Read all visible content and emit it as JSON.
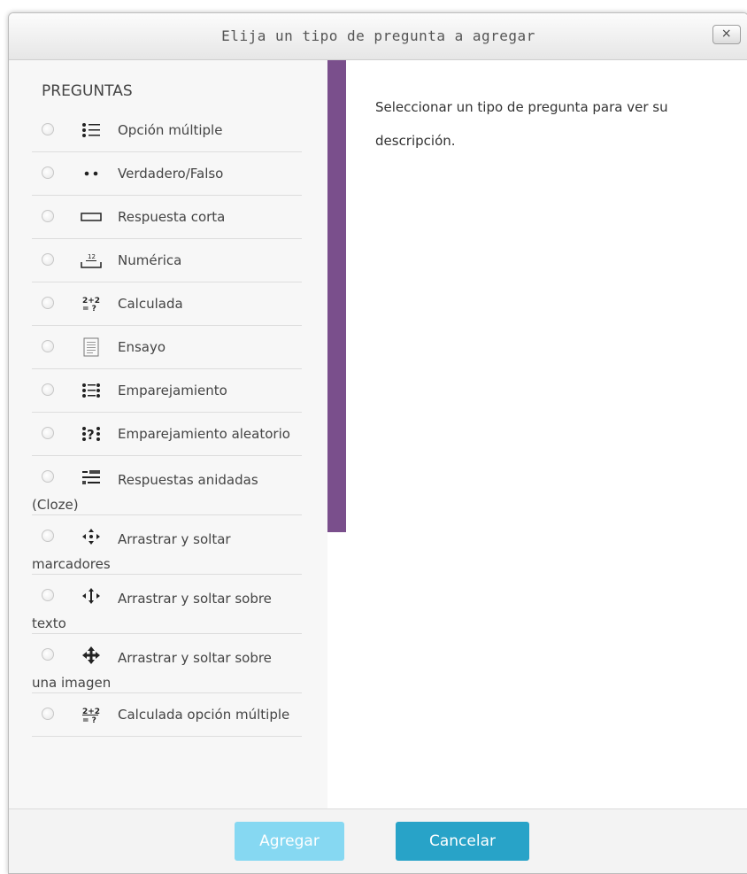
{
  "dialog": {
    "title": "Elija un tipo de pregunta a agregar",
    "close_label": "×",
    "section_title": "PREGUNTAS",
    "description": "Seleccionar un tipo de pregunta para ver su descripción.",
    "questions": [
      {
        "label": "Opción múltiple",
        "icon": "multichoice-icon"
      },
      {
        "label": "Verdadero/Falso",
        "icon": "truefalse-icon"
      },
      {
        "label": "Respuesta corta",
        "icon": "shortanswer-icon"
      },
      {
        "label": "Numérica",
        "icon": "numerical-icon"
      },
      {
        "label": "Calculada",
        "icon": "calculated-icon"
      },
      {
        "label": "Ensayo",
        "icon": "essay-icon"
      },
      {
        "label": "Emparejamiento",
        "icon": "matching-icon"
      },
      {
        "label": "Emparejamiento aleatorio",
        "icon": "randommatching-icon"
      },
      {
        "label": "Respuestas anidadas (Cloze)",
        "icon": "cloze-icon"
      },
      {
        "label": "Arrastrar y soltar marcadores",
        "icon": "dragdrop-markers-icon"
      },
      {
        "label": "Arrastrar y soltar sobre texto",
        "icon": "dragdrop-text-icon"
      },
      {
        "label": "Arrastrar y soltar sobre una imagen",
        "icon": "dragdrop-image-icon"
      },
      {
        "label": "Calculada opción múltiple",
        "icon": "calculated-multichoice-icon"
      }
    ],
    "add_label": "Agregar",
    "cancel_label": "Cancelar"
  }
}
